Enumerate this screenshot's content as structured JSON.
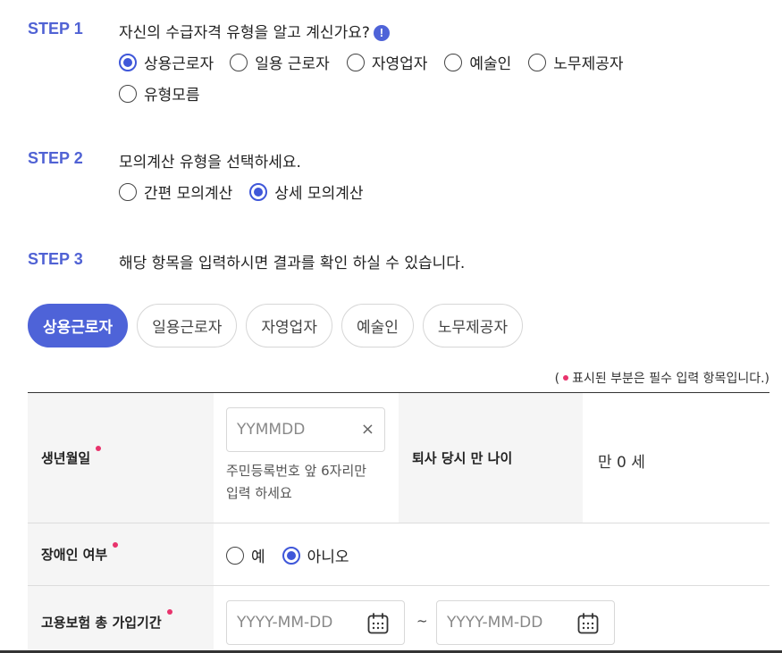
{
  "step1": {
    "label": "STEP 1",
    "title": "자신의 수급자격 유형을 알고 계신가요?",
    "info_icon": "!",
    "options": [
      "상용근로자",
      "일용 근로자",
      "자영업자",
      "예술인",
      "노무제공자",
      "유형모름"
    ],
    "selected": "상용근로자"
  },
  "step2": {
    "label": "STEP 2",
    "title": "모의계산 유형을 선택하세요.",
    "options": [
      "간편 모의계산",
      "상세 모의계산"
    ],
    "selected": "상세 모의계산"
  },
  "step3": {
    "label": "STEP 3",
    "title": "해당 항목을 입력하시면 결과를 확인 하실 수 있습니다."
  },
  "tabs": [
    "상용근로자",
    "일용근로자",
    "자영업자",
    "예술인",
    "노무제공자"
  ],
  "active_tab": "상용근로자",
  "required_note": {
    "open": "(",
    "text": "표시된 부분은 필수 입력 항목입니다.)"
  },
  "form": {
    "birth": {
      "label": "생년월일",
      "placeholder": "YYMMDD",
      "clear": "×",
      "helper_line1": "주민등록번호 앞 6자리만",
      "helper_line2": "입력 하세요"
    },
    "age": {
      "label": "퇴사 당시 만 나이",
      "value": "만 0 세"
    },
    "disability": {
      "label": "장애인 여부",
      "options": [
        "예",
        "아니오"
      ],
      "selected": "아니오"
    },
    "insurance": {
      "label": "고용보험 총 가입기간",
      "start_placeholder": "YYYY-MM-DD",
      "end_placeholder": "YYYY-MM-DD",
      "separator": "~"
    }
  },
  "colors": {
    "accent": "#4e63d8",
    "step_label": "#5062d4",
    "required_dot": "#e8336c"
  }
}
